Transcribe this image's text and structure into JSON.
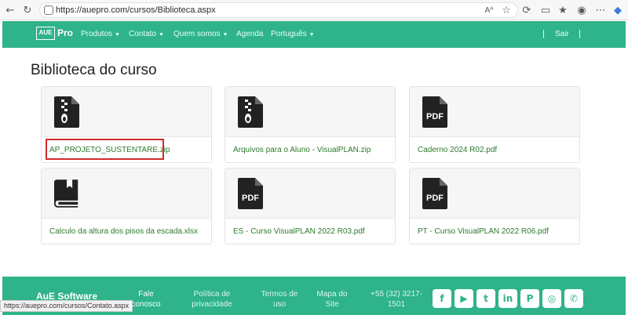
{
  "browser": {
    "url": "https://auepro.com/cursos/Biblioteca.aspx",
    "status_url": "https://auepro.com/cursos/Contato.aspx",
    "back": "←",
    "reload": "↻",
    "zoom_text": "Aᴬ"
  },
  "nav": {
    "logo_box": "AUE",
    "logo_word": "Pro",
    "items": [
      {
        "label": "Produtos",
        "has_caret": true
      },
      {
        "label": "Contato",
        "has_caret": true
      },
      {
        "label": "Quem somos",
        "has_caret": true
      },
      {
        "label": "Agenda",
        "has_caret": false
      },
      {
        "label": "Português",
        "has_caret": true
      }
    ],
    "caret": "▼",
    "sair": "Sair",
    "separator": "|"
  },
  "main": {
    "title": "Biblioteca do curso",
    "files": [
      {
        "name": "AP_PROJETO_SUSTENTARE.zip",
        "icon": "zip-file-icon"
      },
      {
        "name": "Arquivos para o Aluno - VisualPLAN.zip",
        "icon": "zip-file-icon"
      },
      {
        "name": "Caderno 2024 R02.pdf",
        "icon": "pdf-file-icon"
      },
      {
        "name": "Calculo da altura dos pisos da escada.xlsx",
        "icon": "book-icon"
      },
      {
        "name": "ES - Curso VisualPLAN 2022 R03.pdf",
        "icon": "pdf-file-icon"
      },
      {
        "name": "PT - Curso VisualPLAN 2022 R06.pdf",
        "icon": "pdf-file-icon"
      }
    ],
    "pdf_label": "PDF"
  },
  "footer": {
    "logo": "AuE Software",
    "links": [
      {
        "line1": "Fale",
        "line2": "conosco"
      },
      {
        "line1": "Política de",
        "line2": "privacidade"
      },
      {
        "line1": "Termos de",
        "line2": "uso"
      },
      {
        "line1": "Mapa do",
        "line2": "Site"
      },
      {
        "line1": "+55 (32) 3217-",
        "line2": "1501"
      }
    ],
    "social": [
      {
        "icon": "facebook-icon",
        "glyph": "f"
      },
      {
        "icon": "youtube-icon",
        "glyph": "▶"
      },
      {
        "icon": "twitter-icon",
        "glyph": "t"
      },
      {
        "icon": "linkedin-icon",
        "glyph": "in"
      },
      {
        "icon": "pinterest-icon",
        "glyph": "P"
      },
      {
        "icon": "instagram-icon",
        "glyph": "◎"
      },
      {
        "icon": "whatsapp-icon",
        "glyph": "✆"
      }
    ]
  },
  "colors": {
    "brand": "#2eb38a",
    "link": "#2c7a2c",
    "highlight": "#d12b2b"
  }
}
